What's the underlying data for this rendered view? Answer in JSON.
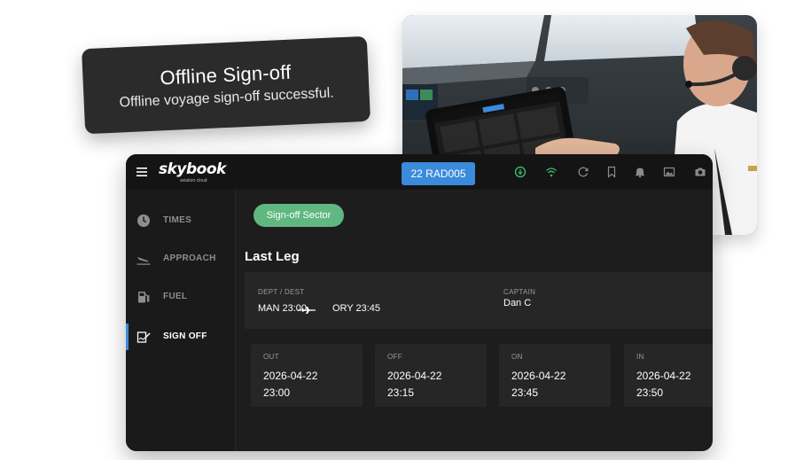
{
  "toast": {
    "title": "Offline Sign-off",
    "message": "Offline voyage sign-off successful."
  },
  "brand": {
    "name": "skybook",
    "tagline": "aviation cloud"
  },
  "topbar": {
    "flight_button": "22 RAD005",
    "icons": [
      "sync-status-icon",
      "wifi-icon",
      "refresh-icon",
      "bookmark-icon",
      "bell-icon",
      "gallery-icon",
      "camera-icon"
    ],
    "status_color": "#36b86b"
  },
  "sidebar": {
    "items": [
      {
        "label": "TIMES",
        "icon": "clock-icon",
        "active": false
      },
      {
        "label": "APPROACH",
        "icon": "landing-icon",
        "active": false
      },
      {
        "label": "FUEL",
        "icon": "fuel-pump-icon",
        "active": false
      },
      {
        "label": "SIGN OFF",
        "icon": "signature-icon",
        "active": true
      }
    ]
  },
  "main": {
    "signoff_button": "Sign-off Sector",
    "section_title": "Last Leg",
    "leg": {
      "route_label": "DEPT / DEST",
      "dep": "MAN 23:00",
      "dest": "ORY 23:45",
      "captain_label": "CAPTAIN",
      "captain": "Dan C"
    },
    "times": [
      {
        "label": "OUT",
        "date": "2026-04-22",
        "time": "23:00"
      },
      {
        "label": "OFF",
        "date": "2026-04-22",
        "time": "23:15"
      },
      {
        "label": "ON",
        "date": "2026-04-22",
        "time": "23:45"
      },
      {
        "label": "IN",
        "date": "2026-04-22",
        "time": "23:50"
      }
    ]
  },
  "colors": {
    "accent_blue": "#3a8bdb",
    "signoff_green": "#5fb87f",
    "app_background": "#1d1d1d"
  }
}
